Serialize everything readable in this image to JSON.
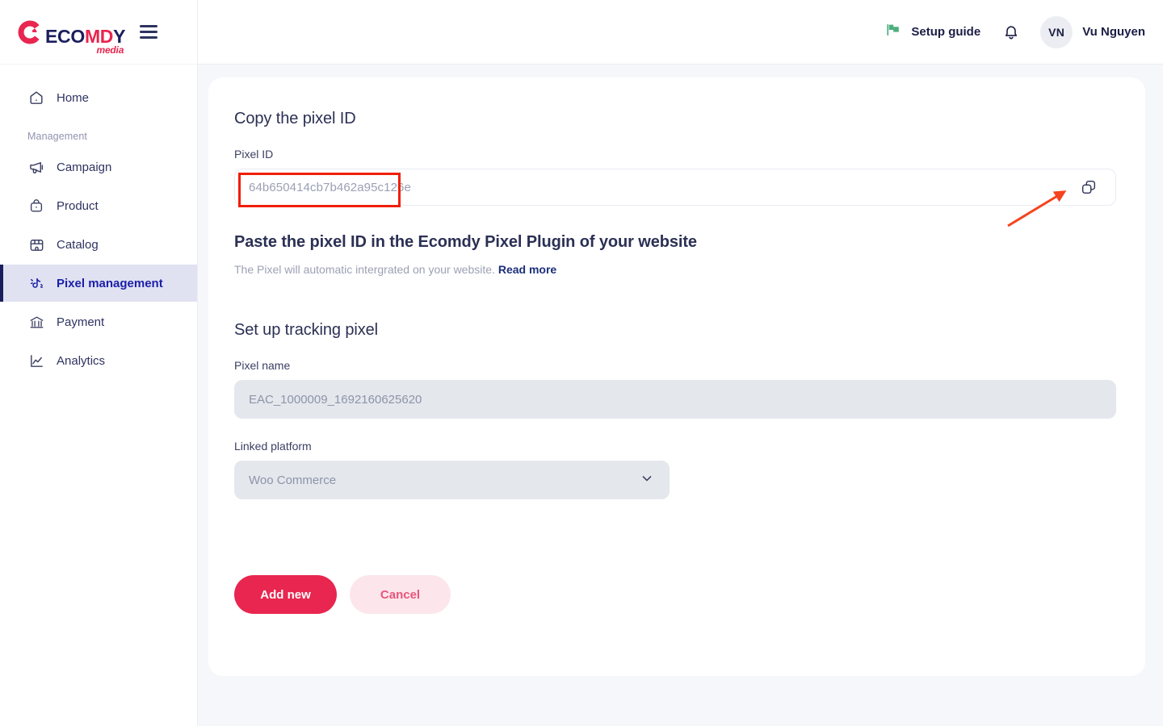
{
  "brand": {
    "word_part1": "E",
    "word_part2": "CO",
    "word_part3": "MD",
    "word_part4": "Y",
    "sub": "media",
    "full_name": "ECOMDY media"
  },
  "sidebar": {
    "section_label": "Management",
    "items": [
      {
        "label": "Home",
        "icon": "home-icon",
        "active": false
      },
      {
        "label": "Campaign",
        "icon": "megaphone-icon",
        "active": false
      },
      {
        "label": "Product",
        "icon": "shopping-bag-icon",
        "active": false
      },
      {
        "label": "Catalog",
        "icon": "store-icon",
        "active": false
      },
      {
        "label": "Pixel management",
        "icon": "pixel-note-icon",
        "active": true
      },
      {
        "label": "Payment",
        "icon": "bank-icon",
        "active": false
      },
      {
        "label": "Analytics",
        "icon": "chart-line-icon",
        "active": false
      }
    ]
  },
  "topbar": {
    "setup_guide_label": "Setup guide",
    "flag_icon": "green-flag-icon",
    "bell_icon": "notification-bell-icon",
    "avatar_initials": "VN",
    "user_name": "Vu Nguyen"
  },
  "main": {
    "copy_section_title": "Copy the pixel ID",
    "pixel_id_label": "Pixel ID",
    "pixel_id_value": "64b650414cb7b462a95c126e",
    "copy_icon": "copy-icon",
    "paste_heading": "Paste the pixel ID in the Ecomdy Pixel Plugin of your website",
    "paste_note": "The Pixel will automatic intergrated on your website.",
    "read_more_label": "Read more",
    "setup_section_title": "Set up tracking pixel",
    "pixel_name_label": "Pixel name",
    "pixel_name_value": "EAC_1000009_1692160625620",
    "linked_platform_label": "Linked platform",
    "linked_platform_value": "Woo Commerce",
    "chevron_icon": "chevron-down-icon",
    "add_new_label": "Add new",
    "cancel_label": "Cancel"
  },
  "colors": {
    "brand_red": "#E8264F",
    "brand_navy": "#1B1E5C",
    "active_nav_bg": "#E0E2F2",
    "page_bg": "#F6F7FB",
    "annotation_red": "#F01E00",
    "flag_green": "#4CAF7D"
  }
}
